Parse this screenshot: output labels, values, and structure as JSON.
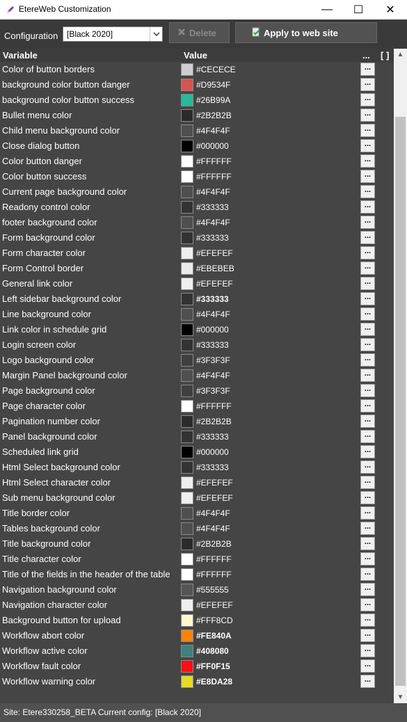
{
  "window": {
    "title": "EtereWeb Customization",
    "minimize": "—",
    "maximize": "☐",
    "close": "✕"
  },
  "toolbar": {
    "config_label": "Configuration",
    "config_value": "[Black 2020]",
    "delete_label": "Delete",
    "apply_label": "Apply to web site"
  },
  "table": {
    "col_variable": "Variable",
    "col_value": "Value",
    "col_more": "...",
    "col_extra": "[ ]",
    "button_label": "...",
    "rows": [
      {
        "name": "Color of  button borders",
        "value": "#CECECE",
        "color": "#CECECE",
        "bold": false
      },
      {
        "name": "background color button danger",
        "value": "#D9534F",
        "color": "#D9534F",
        "bold": false
      },
      {
        "name": "background color button success",
        "value": "#26B99A",
        "color": "#26B99A",
        "bold": false
      },
      {
        "name": "Bullet menu color",
        "value": "#2B2B2B",
        "color": "#2B2B2B",
        "bold": false
      },
      {
        "name": "Child menu background color",
        "value": "#4F4F4F",
        "color": "#4F4F4F",
        "bold": false
      },
      {
        "name": "Close dialog button",
        "value": "#000000",
        "color": "#000000",
        "bold": false
      },
      {
        "name": "Color button danger",
        "value": "#FFFFFF",
        "color": "#FFFFFF",
        "bold": false
      },
      {
        "name": "Color button success",
        "value": "#FFFFFF",
        "color": "#FFFFFF",
        "bold": false
      },
      {
        "name": "Current page background color",
        "value": "#4F4F4F",
        "color": "#4F4F4F",
        "bold": false
      },
      {
        "name": "Readony control color",
        "value": "#333333",
        "color": "#333333",
        "bold": false
      },
      {
        "name": "footer background color",
        "value": "#4F4F4F",
        "color": "#4F4F4F",
        "bold": false
      },
      {
        "name": "Form background color",
        "value": "#333333",
        "color": "#333333",
        "bold": false
      },
      {
        "name": "Form character color",
        "value": "#EFEFEF",
        "color": "#EFEFEF",
        "bold": false
      },
      {
        "name": "Form Control border",
        "value": "#EBEBEB",
        "color": "#EBEBEB",
        "bold": false
      },
      {
        "name": "General link color",
        "value": "#EFEFEF",
        "color": "#EFEFEF",
        "bold": false
      },
      {
        "name": "Left sidebar background color",
        "value": "#333333",
        "color": "#333333",
        "bold": true
      },
      {
        "name": "Line background color",
        "value": "#4F4F4F",
        "color": "#4F4F4F",
        "bold": false
      },
      {
        "name": "Link color in schedule grid",
        "value": "#000000",
        "color": "#000000",
        "bold": false
      },
      {
        "name": "Login screen color",
        "value": "#333333",
        "color": "#333333",
        "bold": false
      },
      {
        "name": "Logo  background color",
        "value": "#3F3F3F",
        "color": "#3F3F3F",
        "bold": false
      },
      {
        "name": "Margin Panel background color",
        "value": "#4F4F4F",
        "color": "#4F4F4F",
        "bold": false
      },
      {
        "name": "Page background color",
        "value": "#3F3F3F",
        "color": "#3F3F3F",
        "bold": false
      },
      {
        "name": "Page character color",
        "value": "#FFFFFF",
        "color": "#FFFFFF",
        "bold": false
      },
      {
        "name": "Pagination number color",
        "value": "#2B2B2B",
        "color": "#2B2B2B",
        "bold": false
      },
      {
        "name": "Panel background color",
        "value": "#333333",
        "color": "#333333",
        "bold": false
      },
      {
        "name": "Scheduled link grid",
        "value": "#000000",
        "color": "#000000",
        "bold": false
      },
      {
        "name": "Html Select background color",
        "value": "#333333",
        "color": "#333333",
        "bold": false
      },
      {
        "name": "Html Select character color",
        "value": "#EFEFEF",
        "color": "#EFEFEF",
        "bold": false
      },
      {
        "name": "Sub menu background color",
        "value": "#EFEFEF",
        "color": "#EFEFEF",
        "bold": false
      },
      {
        "name": "Title border color",
        "value": "#4F4F4F",
        "color": "#4F4F4F",
        "bold": false
      },
      {
        "name": "Tables background color",
        "value": "#4F4F4F",
        "color": "#4F4F4F",
        "bold": false
      },
      {
        "name": "Title background color",
        "value": "#2B2B2B",
        "color": "#2B2B2B",
        "bold": false
      },
      {
        "name": "Title character color",
        "value": "#FFFFFF",
        "color": "#FFFFFF",
        "bold": false
      },
      {
        "name": "Title of the fields in the header of the table",
        "value": "#FFFFFF",
        "color": "#FFFFFF",
        "bold": false
      },
      {
        "name": "Navigation background color",
        "value": "#555555",
        "color": "#555555",
        "bold": false
      },
      {
        "name": "Navigation character color",
        "value": "#EFEFEF",
        "color": "#EFEFEF",
        "bold": false
      },
      {
        "name": "Background button for upload",
        "value": "#FFF8CD",
        "color": "#FFF8CD",
        "bold": false
      },
      {
        "name": "Workflow abort color",
        "value": "#FE840A",
        "color": "#FE840A",
        "bold": true
      },
      {
        "name": "Workflow active color",
        "value": "#408080",
        "color": "#408080",
        "bold": true
      },
      {
        "name": "Workflow fault color",
        "value": "#FF0F15",
        "color": "#FF0F15",
        "bold": true
      },
      {
        "name": "Workflow warning color",
        "value": "#E8DA28",
        "color": "#E8DA28",
        "bold": true
      }
    ]
  },
  "status": {
    "text": "Site: Etere330258_BETA   Current config: [Black 2020]"
  }
}
